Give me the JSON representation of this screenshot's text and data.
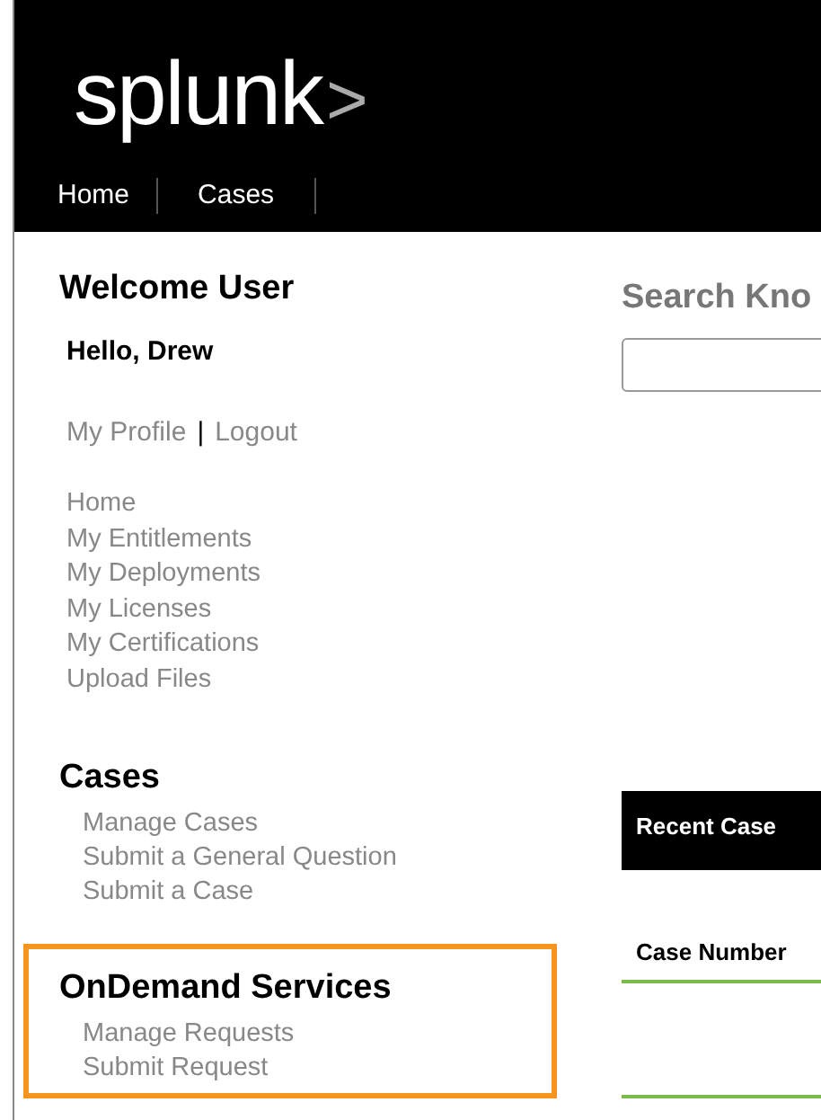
{
  "header": {
    "logo": {
      "word": "splunk",
      "mark": ">"
    },
    "nav": [
      {
        "label": "Home"
      },
      {
        "label": "Cases"
      }
    ]
  },
  "sidebar": {
    "welcome": "Welcome User",
    "greeting": "Hello, Drew",
    "account_links": [
      "My Profile",
      "Logout"
    ],
    "separator": "|",
    "links": [
      "Home",
      "My Entitlements",
      "My Deployments",
      "My Licenses",
      "My Certifications",
      "Upload Files"
    ],
    "sections": [
      {
        "title": "Cases",
        "highlighted": false,
        "links": [
          "Manage Cases",
          "Submit a General Question",
          "Submit a Case"
        ]
      },
      {
        "title": "OnDemand Services",
        "highlighted": true,
        "links": [
          "Manage Requests",
          "Submit Request"
        ]
      }
    ]
  },
  "main": {
    "search": {
      "heading": "Search Kno"
    },
    "recent_cases": {
      "title": "Recent Case",
      "columns": [
        "Case Number"
      ]
    }
  }
}
